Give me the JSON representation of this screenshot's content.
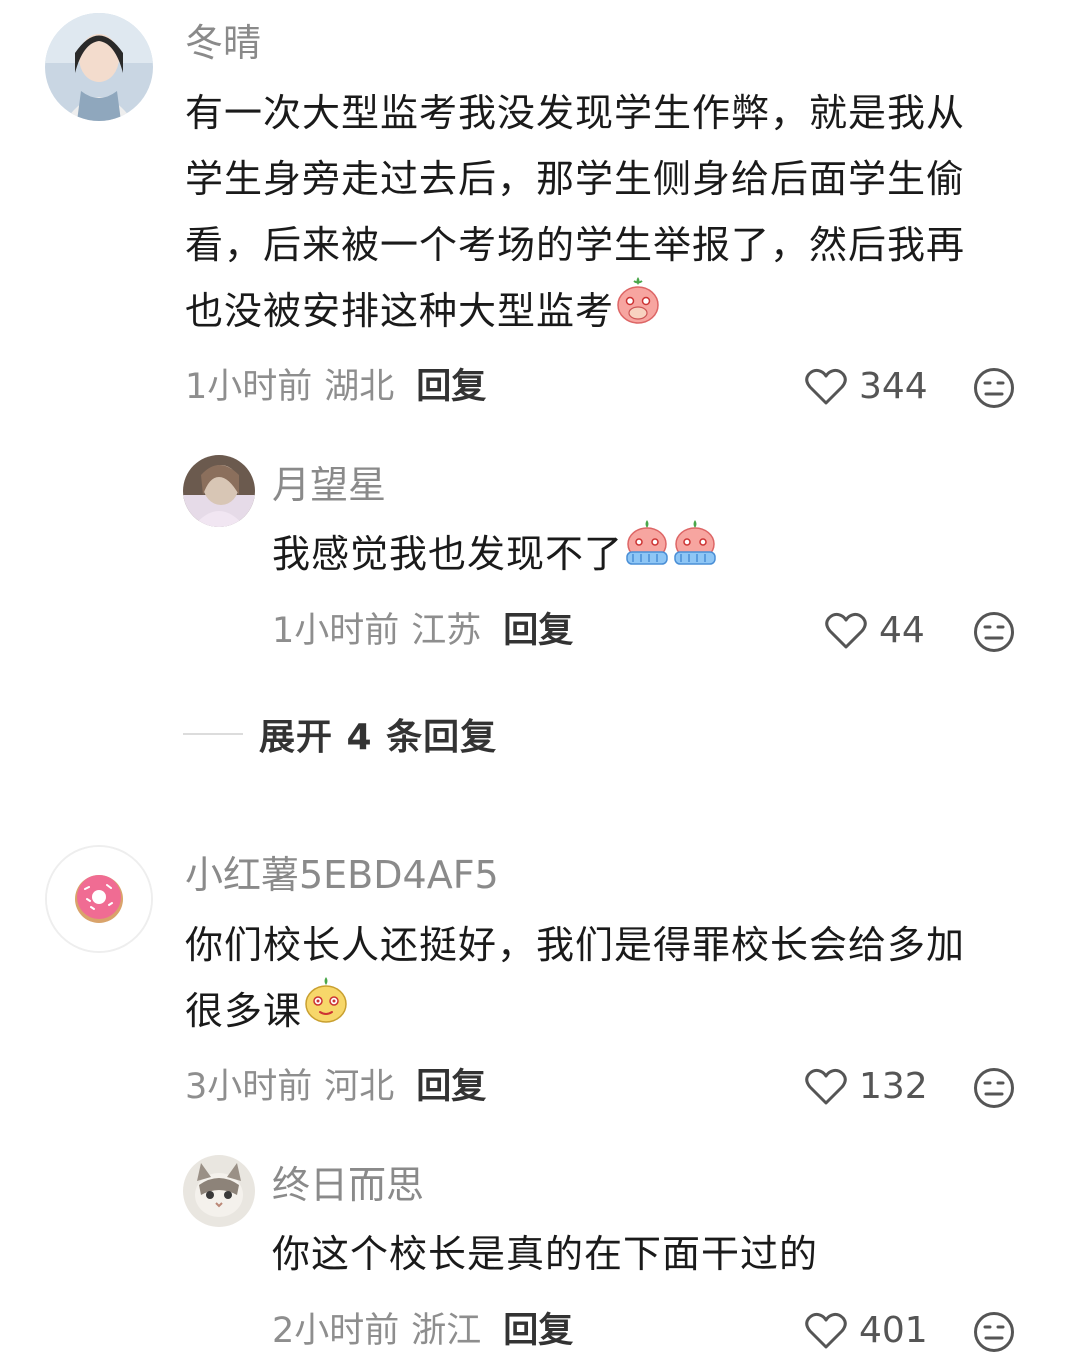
{
  "comments": [
    {
      "username": "冬晴",
      "lines": [
        "有一次大型监考我没发现学生作弊，就是我从",
        "学生身旁走过去后，那学生侧身给后面学生偷",
        "看，后来被一个考场的学生举报了，然后我再",
        "也没被安排这种大型监考"
      ],
      "emoji": "shy-peach-emoji",
      "time": "1小时前",
      "region": "湖北",
      "reply_label": "回复",
      "likes": "344",
      "replies": [
        {
          "username": "月望星",
          "text": "我感觉我也发现不了",
          "emoji": "crying-peach-emoji",
          "time": "1小时前",
          "region": "江苏",
          "reply_label": "回复",
          "likes": "44"
        }
      ],
      "expand_label": "展开 4 条回复"
    },
    {
      "username": "小红薯5EBD4AF5",
      "lines": [
        "你们校长人还挺好，我们是得罪校长会给多加",
        "很多课"
      ],
      "emoji": "smug-peach-emoji",
      "time": "3小时前",
      "region": "河北",
      "reply_label": "回复",
      "likes": "132",
      "replies": [
        {
          "username": "终日而思",
          "text": "你这个校长是真的在下面干过的",
          "time": "2小时前",
          "region": "浙江",
          "reply_label": "回复",
          "likes": "401"
        }
      ]
    }
  ],
  "icons": {
    "like": "heart-outline-icon",
    "dislike": "meh-face-icon"
  },
  "colors": {
    "username": "#8a8a8a",
    "text": "#1a1a1a",
    "meta": "#8e8e8e"
  }
}
